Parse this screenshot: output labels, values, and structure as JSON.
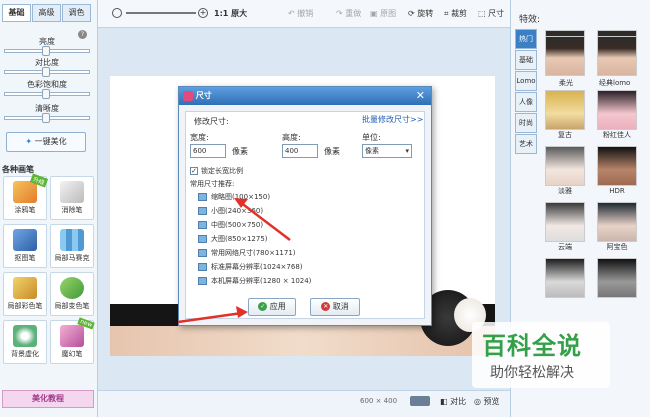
{
  "left": {
    "tabs": [
      "基础",
      "高级",
      "调色"
    ],
    "sliders": [
      "亮度",
      "对比度",
      "色彩饱和度",
      "清晰度"
    ],
    "onekey": "一键美化",
    "section": "各种画笔",
    "tools": [
      {
        "label": "涂鸦笔",
        "badge": "升级"
      },
      {
        "label": "消除笔"
      },
      {
        "label": "抠图笔"
      },
      {
        "label": "局部马赛克"
      },
      {
        "label": "局部彩色笔"
      },
      {
        "label": "局部变色笔"
      },
      {
        "label": "背景虚化"
      },
      {
        "label": "魔幻笔",
        "badge": "new"
      }
    ],
    "tutorial": "美化教程"
  },
  "toolbar": {
    "ratio": "1:1 原大",
    "undo": "撤销",
    "redo": "重做",
    "original": "原图",
    "rotate": "旋转",
    "crop": "裁剪",
    "size": "尺寸"
  },
  "status": {
    "dims": "600 × 400",
    "compare": "对比",
    "preview": "预览"
  },
  "right": {
    "title": "特效:",
    "tabs": [
      "热门",
      "基础",
      "Lomo",
      "人像",
      "时尚",
      "艺术"
    ],
    "effects": [
      "",
      "",
      "柔光",
      "经典lomo",
      "复古",
      "粉红佳人",
      "淡雅",
      "HDR",
      "云端",
      "阿宝色"
    ]
  },
  "dialog": {
    "title": "尺寸",
    "modify_label": "修改尺寸:",
    "batch_link": "批量修改尺寸>>",
    "width_label": "宽度:",
    "width_value": "600",
    "height_label": "高度:",
    "height_value": "400",
    "unit_px": "像素",
    "unit_label": "单位:",
    "unit_value": "像素",
    "lock_ratio": "锁定长宽比例",
    "presets_label": "常用尺寸推荐:",
    "presets": [
      "缩略图(100×150)",
      "小图(240×360)",
      "中图(500×750)",
      "大图(850×1275)",
      "常用网络尺寸(780×1171)",
      "标准屏幕分辨率(1024×768)",
      "本机屏幕分辨率(1280 × 1024)"
    ],
    "apply": "应用",
    "cancel": "取消"
  },
  "watermark": {
    "title": "百科全说",
    "subtitle": "助你轻松解决"
  },
  "colors": {
    "accent": "#3b7fc4",
    "arrow": "#e0322a",
    "watermark": "#35a04a"
  }
}
